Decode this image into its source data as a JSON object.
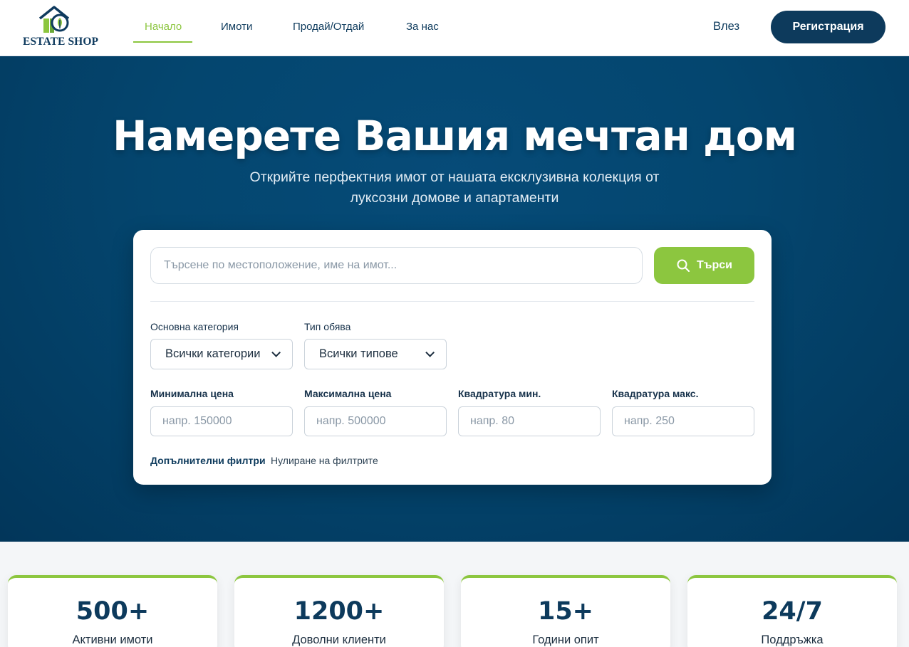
{
  "header": {
    "logo_text": "ESTATE SHOP",
    "nav": [
      {
        "label": "Начало",
        "active": true
      },
      {
        "label": "Имоти",
        "active": false
      },
      {
        "label": "Продай/Отдай",
        "active": false
      },
      {
        "label": "За нас",
        "active": false
      }
    ],
    "login_label": "Влез",
    "register_label": "Регистрация"
  },
  "hero": {
    "title": "Намерете Вашия мечтан дом",
    "subtitle_line1": "Открийте перфектния имот от нашата ексклузивна колекция от",
    "subtitle_line2": "луксозни домове и апартаменти"
  },
  "search": {
    "placeholder": "Търсене по местоположение, име на имот...",
    "button_label": "Търси",
    "category_label": "Основна категория",
    "category_value": "Всички категории",
    "type_label": "Тип обява",
    "type_value": "Всички типове",
    "min_price_label": "Минимална цена",
    "min_price_placeholder": "напр. 150000",
    "max_price_label": "Максимална цена",
    "max_price_placeholder": "напр. 500000",
    "min_area_label": "Квадратура мин.",
    "min_area_placeholder": "напр. 80",
    "max_area_label": "Квадратура макс.",
    "max_area_placeholder": "напр. 250",
    "more_filters_label": "Допълнителни филтри",
    "reset_label": "Нулиране на филтрите"
  },
  "stats": [
    {
      "value": "500+",
      "label": "Активни имоти"
    },
    {
      "value": "1200+",
      "label": "Доволни клиенти"
    },
    {
      "value": "15+",
      "label": "Години опит"
    },
    {
      "value": "24/7",
      "label": "Поддръжка"
    }
  ],
  "colors": {
    "primary": "#0d3a5c",
    "accent": "#8cc63f",
    "hero_bg": "#04466f"
  }
}
